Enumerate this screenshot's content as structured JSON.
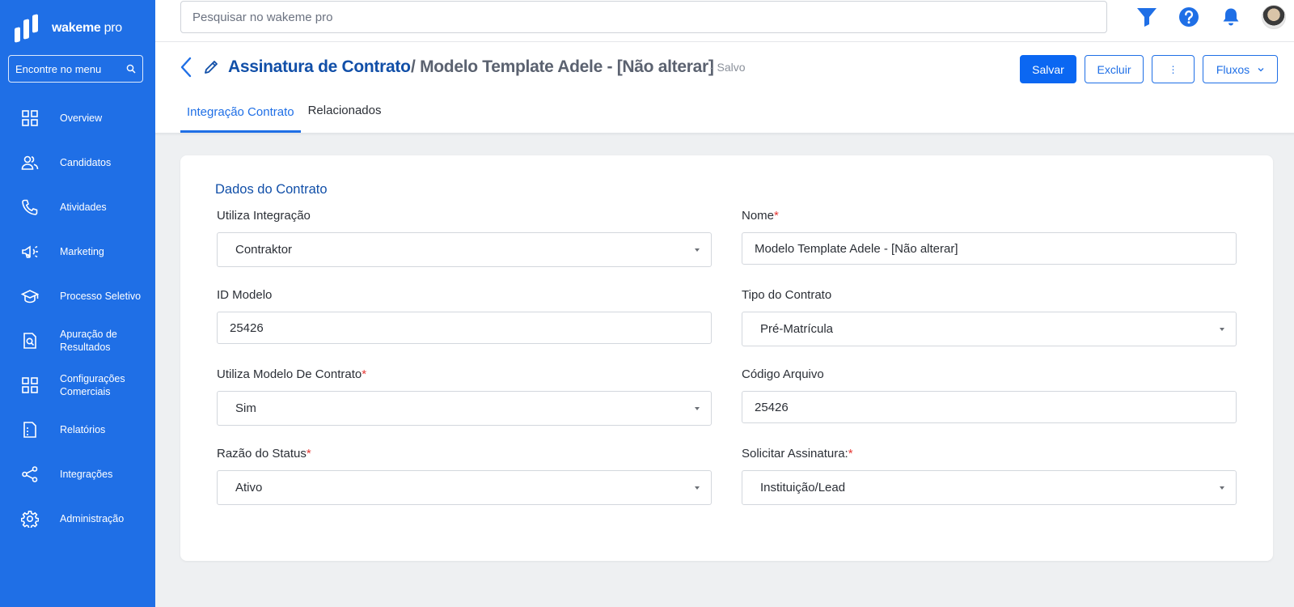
{
  "brand": {
    "name_bold": "wakeme",
    "name_light": " pro"
  },
  "sidebar": {
    "search_placeholder": "Encontre no menu",
    "items": [
      {
        "label": "Overview",
        "icon": "grid-icon"
      },
      {
        "label": "Candidatos",
        "icon": "users-icon"
      },
      {
        "label": "Atividades",
        "icon": "phone-icon"
      },
      {
        "label": "Marketing",
        "icon": "megaphone-icon"
      },
      {
        "label": "Processo Seletivo",
        "icon": "graduation-cap-icon"
      },
      {
        "label": "Apuração de Resultados",
        "icon": "document-search-icon"
      },
      {
        "label": "Configurações Comerciais",
        "icon": "grid-icon"
      },
      {
        "label": "Relatórios",
        "icon": "report-icon"
      },
      {
        "label": "Integrações",
        "icon": "share-icon"
      },
      {
        "label": "Administração",
        "icon": "gear-icon"
      }
    ]
  },
  "topbar": {
    "search_placeholder": "Pesquisar no wakeme pro"
  },
  "header": {
    "title": "Assinatura de Contrato",
    "subtitle": "/ Modelo Template Adele - [Não alterar]",
    "status": "- Salvo",
    "buttons": {
      "save": "Salvar",
      "delete": "Excluir",
      "more": "⋮",
      "flows": "Fluxos"
    },
    "tabs": [
      {
        "label": "Integração Contrato",
        "active": true
      },
      {
        "label": "Relacionados",
        "active": false
      }
    ]
  },
  "form": {
    "section_title": "Dados do Contrato",
    "fields": {
      "utiliza_integracao": {
        "label": "Utiliza Integração",
        "value": "Contraktor"
      },
      "nome": {
        "label": "Nome",
        "required": "*",
        "value": "Modelo Template Adele - [Não alterar]"
      },
      "id_modelo": {
        "label": "ID Modelo",
        "value": "25426"
      },
      "tipo_contrato": {
        "label": "Tipo do Contrato",
        "value": "Pré-Matrícula"
      },
      "utiliza_modelo": {
        "label": "Utiliza Modelo De Contrato",
        "required": "*",
        "value": "Sim"
      },
      "codigo_arquivo": {
        "label": "Código Arquivo",
        "value": "25426"
      },
      "razao_status": {
        "label": "Razão do Status",
        "required": "*",
        "value": "Ativo"
      },
      "solicitar_assinatura": {
        "label": "Solicitar Assinatura:",
        "required": "*",
        "value": "Instituição/Lead"
      }
    }
  },
  "colors": {
    "sidebar": "#1f6fe6",
    "primary": "#0b67f2",
    "title": "#114fa8",
    "required": "#e53935"
  }
}
